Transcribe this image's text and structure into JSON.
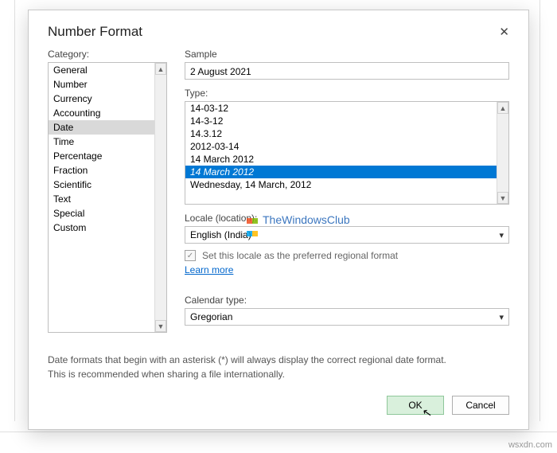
{
  "dialog": {
    "title": "Number Format",
    "close_icon": "✕"
  },
  "category": {
    "label": "Category:",
    "items": [
      "General",
      "Number",
      "Currency",
      "Accounting",
      "Date",
      "Time",
      "Percentage",
      "Fraction",
      "Scientific",
      "Text",
      "Special",
      "Custom"
    ],
    "selected": "Date"
  },
  "sample": {
    "label": "Sample",
    "value": "2 August 2021"
  },
  "type": {
    "label": "Type:",
    "items": [
      "14-03-12",
      "14-3-12",
      "14.3.12",
      "2012-03-14",
      "14 March 2012",
      "14 March 2012",
      "Wednesday, 14 March, 2012"
    ],
    "selected_index": 5
  },
  "locale": {
    "label": "Locale (location):",
    "value": "English (India)",
    "checkbox_label": "Set this locale as the preferred regional format",
    "checkbox_checked": true,
    "learn_more": "Learn more"
  },
  "calendar": {
    "label": "Calendar type:",
    "value": "Gregorian"
  },
  "note": {
    "line1": "Date formats that begin with an asterisk (*) will always display the correct regional date format.",
    "line2": "This is recommended when sharing a file internationally."
  },
  "buttons": {
    "ok": "OK",
    "cancel": "Cancel"
  },
  "watermark": "TheWindowsClub",
  "footer": "wsxdn.com"
}
